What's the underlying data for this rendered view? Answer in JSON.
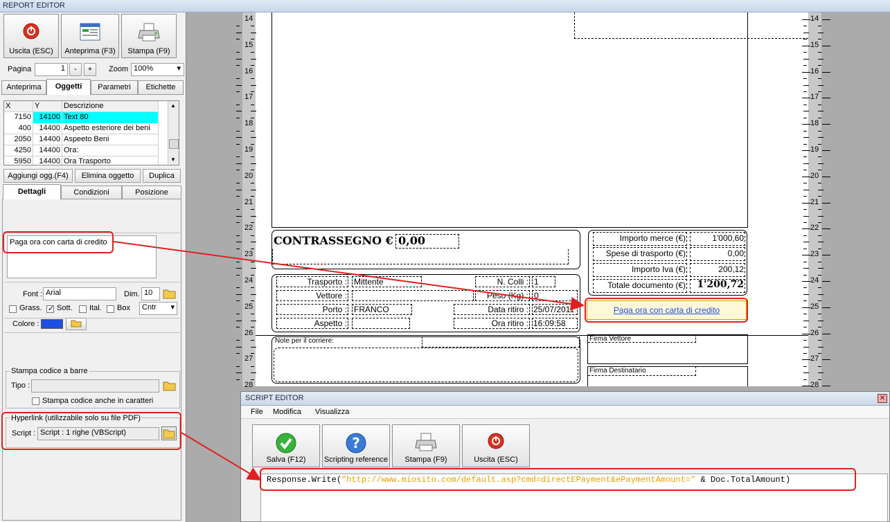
{
  "window": {
    "title": "REPORT EDITOR"
  },
  "toolbar": {
    "exit_label": "Uscita (ESC)",
    "preview_label": "Anteprima (F3)",
    "print_label": "Stampa (F9)",
    "page_label": "Pagina",
    "page_value": "1",
    "page_minus": "-",
    "page_plus": "+",
    "zoom_label": "Zoom",
    "zoom_value": "100%"
  },
  "tabs": [
    "Anteprima",
    "Oggetti",
    "Parametri",
    "Etichette"
  ],
  "objects_grid": {
    "headers": [
      "X",
      "Y",
      "Descrizione"
    ],
    "rows": [
      [
        "7150",
        "14100",
        "Text 80"
      ],
      [
        "400",
        "14400",
        "Aspetto esteriore dei beni"
      ],
      [
        "2050",
        "14400",
        "Aspeeto Beni"
      ],
      [
        "4250",
        "14400",
        "Ora:"
      ],
      [
        "5950",
        "14400",
        "Ora Trasporto"
      ]
    ]
  },
  "object_buttons": {
    "add": "Aggiungi ogg.(F4)",
    "delete": "Elimina oggetto",
    "duplicate": "Duplica"
  },
  "detail_tabs": [
    "Dettagli",
    "Condizioni",
    "Posizione"
  ],
  "details": {
    "text_value": "Paga ora con carta di credito",
    "font_label": "Font :",
    "font_value": "Arial",
    "dim_label": "Dim.",
    "dim_value": "10",
    "bold_label": "Grass.",
    "underline_label": "Sott.",
    "italic_label": "Ital.",
    "box_label": "Box",
    "align_value": "Cntr",
    "color_label": "Colore :",
    "color": "#1f4fe0",
    "barcode_title": "Stampa codice a barre",
    "barcode_type_label": "Tipo :",
    "barcode_chars_label": "Stampa codice anche in caratteri",
    "hyperlink_title": "Hyperlink (utilizzabile solo su file PDF)",
    "script_label": "Script :",
    "script_value": "Script : 1 righe (VBScript)"
  },
  "ruler": {
    "numbers": [
      "14",
      "15",
      "16",
      "17",
      "18",
      "19",
      "20",
      "21",
      "22",
      "23",
      "24",
      "25",
      "26",
      "27",
      "28"
    ]
  },
  "document": {
    "contrassegno_label": "CONTRASSEGNO €",
    "contrassegno_value": "0,00",
    "importo_merce_label": "Importo merce (€)",
    "importo_merce_value": "1'000,60",
    "spese_label": "Spese di trasporto (€)",
    "spese_value": "0,00",
    "iva_label": "Importo Iva (€)",
    "iva_value": "200,12",
    "totale_label": "Totale documento (€)",
    "totale_value": "1'200,72",
    "trasporto_label": "Trasporto :",
    "trasporto_value": "Mittente",
    "vettore_label": "Vettore :",
    "porto_label": "Porto :",
    "porto_value": "FRANCO",
    "aspetto_label": "Aspetto :",
    "colli_label": "N. Colli :",
    "colli_value": "1",
    "peso_label": "Peso (Kg) :",
    "peso_value": "0",
    "data_ritiro_label": "Data ritiro :",
    "data_ritiro_value": "25/07/2011",
    "ora_ritiro_label": "Ora ritiro :",
    "ora_ritiro_value": "16:09:58",
    "note_label": "Note  per il corriere:",
    "firma_vettore": "Firma Vettore",
    "firma_destinatario": "Firma Destinatario",
    "pay_link": "Paga ora con carta di credito"
  },
  "script_editor": {
    "title": "SCRIPT EDITOR",
    "menu": [
      "File",
      "Modifica",
      "Visualizza"
    ],
    "save_label": "Salva (F12)",
    "reference_label": "Scripting reference",
    "print_label": "Stampa (F9)",
    "exit_label": "Uscita (ESC)",
    "code_prefix": "Response.Write(",
    "code_string": "\"http://www.miosito.com/default.asp?cmd=directEPayment&ePaymentAmount=\"",
    "code_suffix": " & Doc.TotalAmount)"
  },
  "colors": {
    "selected_row": "#00ffff",
    "annotation": "#e02020",
    "link": "#1f4fe0",
    "code_string": "#e8a000"
  }
}
